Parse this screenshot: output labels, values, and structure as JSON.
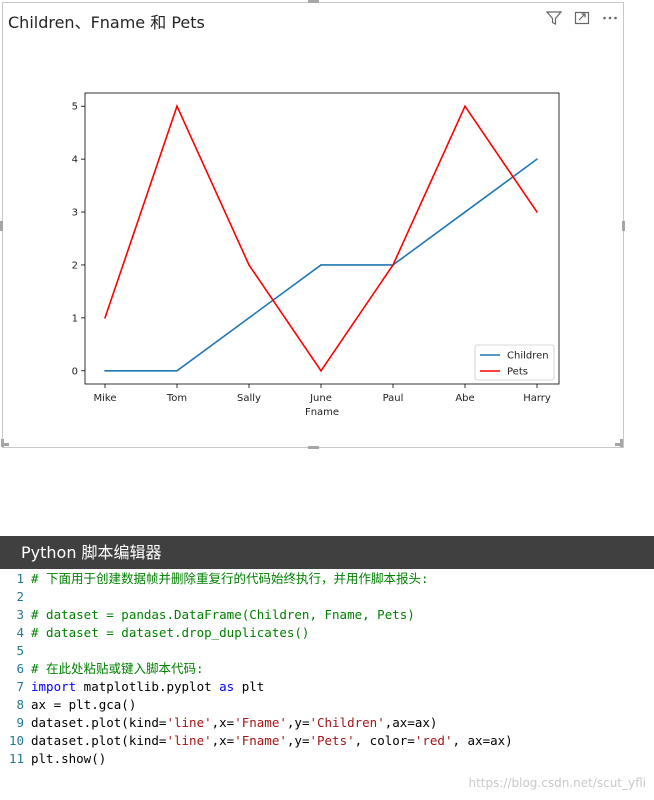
{
  "visual": {
    "title": "Children、Fname 和 Pets",
    "icons": [
      "filter-icon",
      "focus-mode-icon",
      "more-options-icon"
    ]
  },
  "chart_data": {
    "type": "line",
    "categories": [
      "Mike",
      "Tom",
      "Sally",
      "June",
      "Paul",
      "Abe",
      "Harry"
    ],
    "series": [
      {
        "name": "Children",
        "values": [
          0,
          0,
          1,
          2,
          2,
          3,
          4
        ],
        "color": "#1f77b4"
      },
      {
        "name": "Pets",
        "values": [
          1,
          5,
          2,
          0,
          2,
          5,
          3
        ],
        "color": "#ff0000"
      }
    ],
    "xlabel": "Fname",
    "ylabel": "",
    "yticks": [
      0,
      1,
      2,
      3,
      4,
      5
    ],
    "ylim": [
      -0.25,
      5.25
    ],
    "grid": false,
    "legend": "bottom-right"
  },
  "editor": {
    "title": "Python 脚本编辑器",
    "lines": [
      [
        {
          "t": "comment",
          "v": "# 下面用于创建数据帧并删除重复行的代码始终执行，并用作脚本报头:"
        }
      ],
      [],
      [
        {
          "t": "comment",
          "v": "# dataset = pandas.DataFrame(Children, Fname, Pets)"
        }
      ],
      [
        {
          "t": "comment",
          "v": "# dataset = dataset.drop_duplicates()"
        }
      ],
      [],
      [
        {
          "t": "comment",
          "v": "# 在此处粘贴或键入脚本代码:"
        }
      ],
      [
        {
          "t": "keyword",
          "v": "import"
        },
        {
          "t": "plain",
          "v": " matplotlib.pyplot "
        },
        {
          "t": "keyword",
          "v": "as"
        },
        {
          "t": "plain",
          "v": " plt"
        }
      ],
      [
        {
          "t": "plain",
          "v": "ax = plt.gca()"
        }
      ],
      [
        {
          "t": "plain",
          "v": "dataset.plot(kind="
        },
        {
          "t": "string",
          "v": "'line'"
        },
        {
          "t": "plain",
          "v": ",x="
        },
        {
          "t": "string",
          "v": "'Fname'"
        },
        {
          "t": "plain",
          "v": ",y="
        },
        {
          "t": "string",
          "v": "'Children'"
        },
        {
          "t": "plain",
          "v": ",ax=ax)"
        }
      ],
      [
        {
          "t": "plain",
          "v": "dataset.plot(kind="
        },
        {
          "t": "string",
          "v": "'line'"
        },
        {
          "t": "plain",
          "v": ",x="
        },
        {
          "t": "string",
          "v": "'Fname'"
        },
        {
          "t": "plain",
          "v": ",y="
        },
        {
          "t": "string",
          "v": "'Pets'"
        },
        {
          "t": "plain",
          "v": ", color="
        },
        {
          "t": "string",
          "v": "'red'"
        },
        {
          "t": "plain",
          "v": ", ax=ax)"
        }
      ],
      [
        {
          "t": "plain",
          "v": "plt.show()"
        }
      ]
    ]
  },
  "watermark": "https://blog.csdn.net/scut_yfli"
}
